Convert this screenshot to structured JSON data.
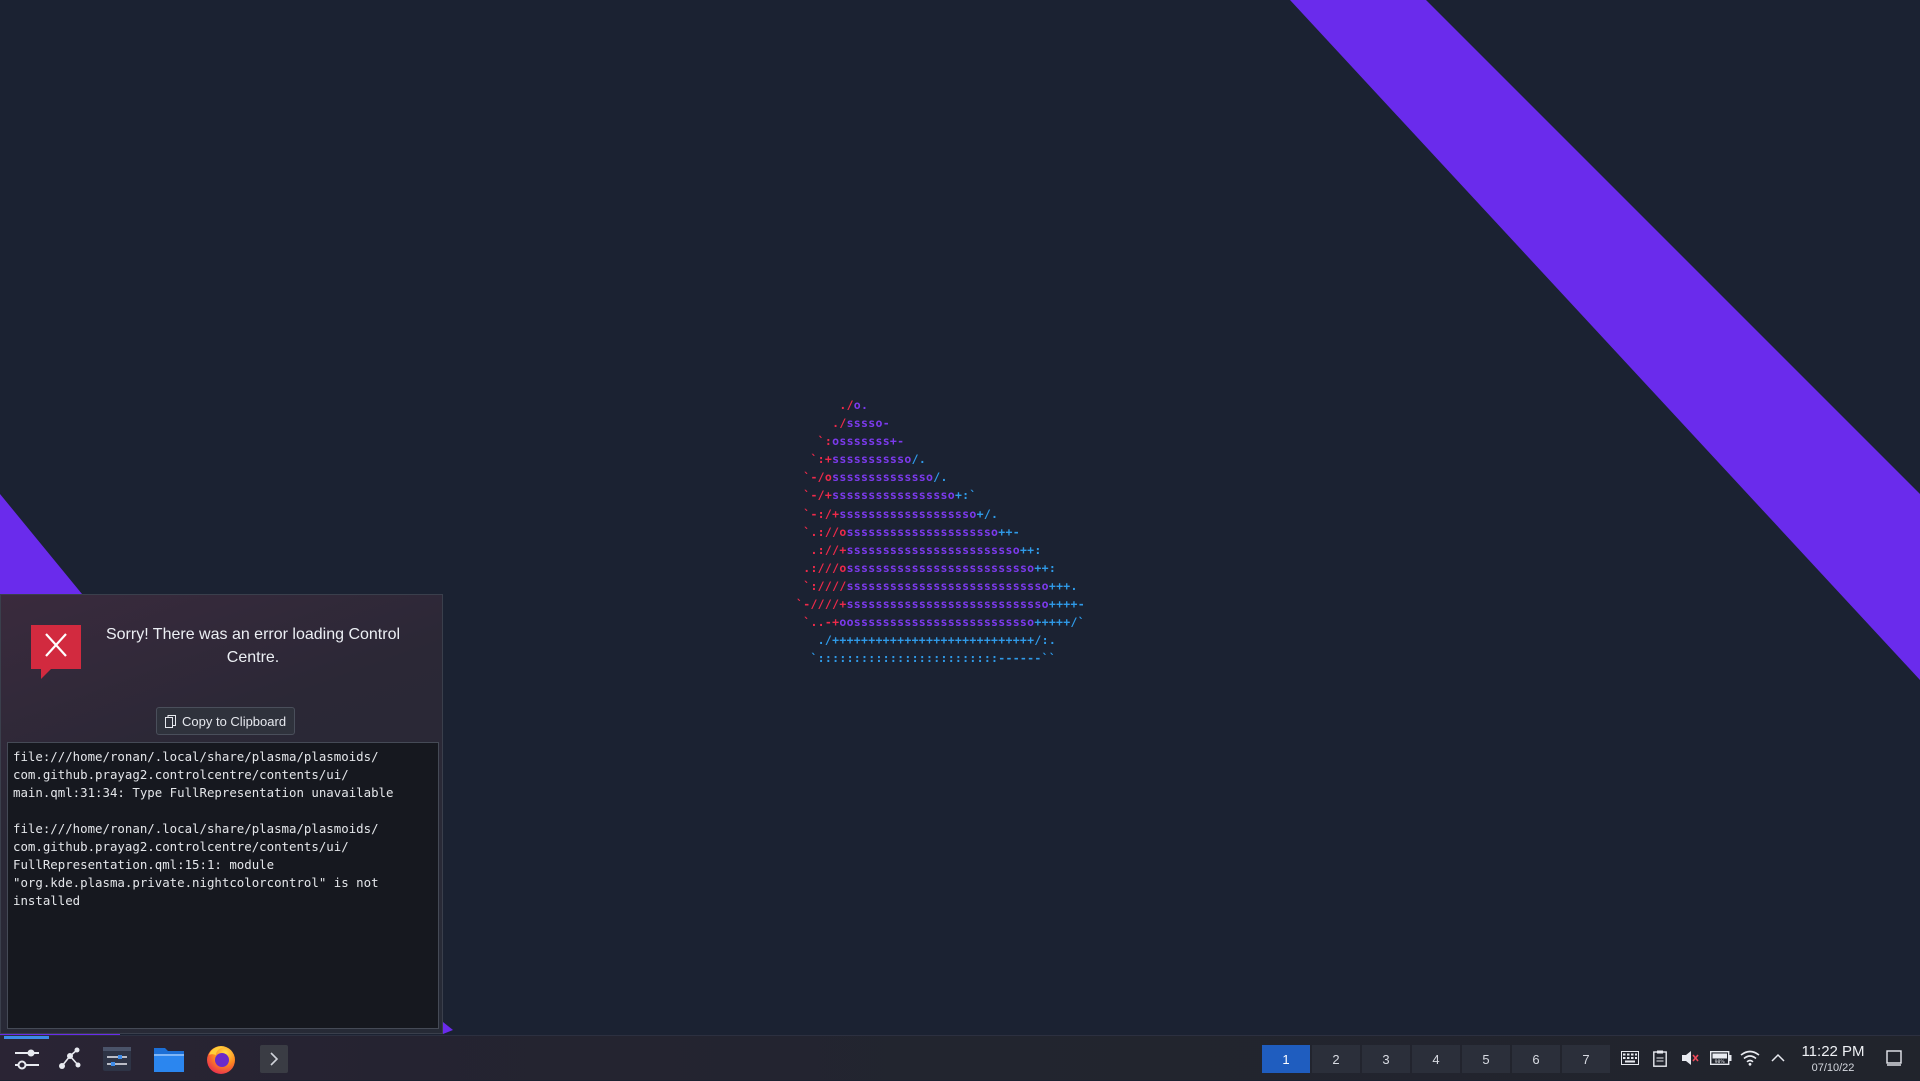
{
  "colors": {
    "accent": "#6a2bec",
    "logo_red": "#ee2a4a",
    "logo_purple": "#7c3aed",
    "logo_blue": "#2f9ae8",
    "error_red": "#d22a3f",
    "pager_active": "#1f5dbf"
  },
  "ascii_logo": [
    [
      {
        "c": "r",
        "t": "      ./"
      },
      {
        "c": "p",
        "t": "o."
      }
    ],
    [
      {
        "c": "r",
        "t": "     ./"
      },
      {
        "c": "p",
        "t": "sssso-"
      }
    ],
    [
      {
        "c": "r",
        "t": "   `:"
      },
      {
        "c": "p",
        "t": "osssssss+-"
      }
    ],
    [
      {
        "c": "r",
        "t": "  `:+"
      },
      {
        "c": "p",
        "t": "sssssssssso"
      },
      {
        "c": "b",
        "t": "/."
      }
    ],
    [
      {
        "c": "r",
        "t": " `-/o"
      },
      {
        "c": "p",
        "t": "ssssssssssssso"
      },
      {
        "c": "b",
        "t": "/."
      }
    ],
    [
      {
        "c": "r",
        "t": " `-/+"
      },
      {
        "c": "p",
        "t": "sssssssssssssssso"
      },
      {
        "c": "b",
        "t": "+:`"
      }
    ],
    [
      {
        "c": "r",
        "t": " `-:/+"
      },
      {
        "c": "p",
        "t": "sssssssssssssssssso"
      },
      {
        "c": "b",
        "t": "+/."
      }
    ],
    [
      {
        "c": "r",
        "t": " `.://o"
      },
      {
        "c": "p",
        "t": "sssssssssssssssssssso"
      },
      {
        "c": "b",
        "t": "++-"
      }
    ],
    [
      {
        "c": "r",
        "t": "  .://+"
      },
      {
        "c": "p",
        "t": "ssssssssssssssssssssssso"
      },
      {
        "c": "b",
        "t": "++:"
      }
    ],
    [
      {
        "c": "r",
        "t": " .:///o"
      },
      {
        "c": "p",
        "t": "ssssssssssssssssssssssssso"
      },
      {
        "c": "b",
        "t": "++:"
      }
    ],
    [
      {
        "c": "r",
        "t": " `:////"
      },
      {
        "c": "p",
        "t": "ssssssssssssssssssssssssssso"
      },
      {
        "c": "b",
        "t": "+++."
      }
    ],
    [
      {
        "c": "r",
        "t": "`-////+"
      },
      {
        "c": "p",
        "t": "ssssssssssssssssssssssssssso"
      },
      {
        "c": "b",
        "t": "++++-"
      }
    ],
    [
      {
        "c": "r",
        "t": " `..-+"
      },
      {
        "c": "p",
        "t": "oosssssssssssssssssssssssso"
      },
      {
        "c": "b",
        "t": "+++++/`"
      }
    ],
    [
      {
        "c": "b",
        "t": "   ./++++++++++++++++++++++++++++/:."
      }
    ],
    [
      {
        "c": "b",
        "t": "  `:::::::::::::::::::::::::------``"
      }
    ]
  ],
  "popup": {
    "message": "Sorry! There was an error loading Control Centre.",
    "copy_label": "Copy to Clipboard",
    "details": "file:///home/ronan/.local/share/plasma/plasmoids/\ncom.github.prayag2.controlcentre/contents/ui/\nmain.qml:31:34: Type FullRepresentation unavailable\n\nfile:///home/ronan/.local/share/plasma/plasmoids/\ncom.github.prayag2.controlcentre/contents/ui/\nFullRepresentation.qml:15:1: module\n\"org.kde.plasma.private.nightcolorcontrol\" is not\ninstalled"
  },
  "taskbar": {
    "launchers": [
      "control-centre-icon",
      "kde-connect-icon",
      "system-settings-icon",
      "file-manager-icon",
      "firefox-icon",
      "terminal-icon"
    ],
    "desktops": [
      "1",
      "2",
      "3",
      "4",
      "5",
      "6",
      "7"
    ],
    "active_desktop": "1",
    "tray": [
      "keyboard-icon",
      "clipboard-icon",
      "volume-muted-icon",
      "battery-icon",
      "wifi-icon",
      "tray-expand-icon"
    ],
    "battery_label": "98%",
    "clock_time": "11:22 PM",
    "clock_date": "07/10/22"
  }
}
